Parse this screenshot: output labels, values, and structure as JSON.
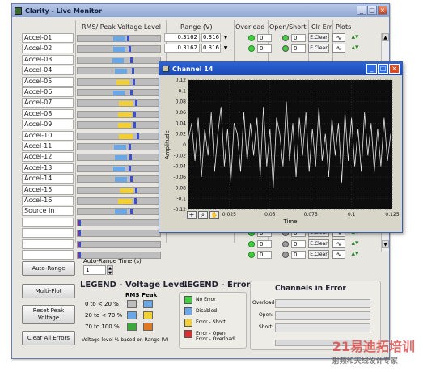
{
  "app": {
    "title": "Clarity - Live Monitor"
  },
  "columns": {
    "rms_peak": "RMS/ Peak Voltage Level",
    "range": "Range (V)",
    "overload": "Overload",
    "open_short": "Open/Short",
    "clr_err": "Clr Err",
    "plots": "Plots"
  },
  "rows": [
    {
      "name": "Accel-01",
      "rms": 0.58,
      "peak": 0.6,
      "range_a": "0.3162",
      "range_b": "0.316",
      "color": "#6aa7e6",
      "overload": "0",
      "open": "0",
      "clear": "E.Clear"
    },
    {
      "name": "Accel-02",
      "rms": 0.58,
      "peak": 0.62,
      "range_a": "0.3162",
      "range_b": "0.316",
      "color": "#6aa7e6",
      "overload": "0",
      "open": "0",
      "clear": "E.Clear"
    },
    {
      "name": "Accel-03",
      "rms": 0.56,
      "peak": 0.64,
      "range_a": "",
      "range_b": "",
      "color": "#6aa7e6",
      "overload": "",
      "open": "",
      "clear": ""
    },
    {
      "name": "Accel-04",
      "rms": 0.6,
      "peak": 0.66,
      "range_a": "",
      "range_b": "",
      "color": "#6aa7e6",
      "overload": "",
      "open": "",
      "clear": ""
    },
    {
      "name": "Accel-05",
      "rms": 0.63,
      "peak": 0.67,
      "range_a": "",
      "range_b": "",
      "color": "#f2d033",
      "overload": "",
      "open": "",
      "clear": ""
    },
    {
      "name": "Accel-06",
      "rms": 0.57,
      "peak": 0.64,
      "range_a": "",
      "range_b": "",
      "color": "#6aa7e6",
      "overload": "",
      "open": "",
      "clear": ""
    },
    {
      "name": "Accel-07",
      "rms": 0.67,
      "peak": 0.7,
      "range_a": "",
      "range_b": "",
      "color": "#f2d033",
      "overload": "",
      "open": "",
      "clear": ""
    },
    {
      "name": "Accel-08",
      "rms": 0.66,
      "peak": 0.68,
      "range_a": "",
      "range_b": "",
      "color": "#f2d033",
      "overload": "",
      "open": "",
      "clear": ""
    },
    {
      "name": "Accel-09",
      "rms": 0.65,
      "peak": 0.68,
      "range_a": "",
      "range_b": "",
      "color": "#f2d033",
      "overload": "",
      "open": "",
      "clear": ""
    },
    {
      "name": "Accel-10",
      "rms": 0.67,
      "peak": 0.72,
      "range_a": "",
      "range_b": "",
      "color": "#f2d033",
      "overload": "",
      "open": "",
      "clear": ""
    },
    {
      "name": "Accel-11",
      "rms": 0.59,
      "peak": 0.62,
      "range_a": "",
      "range_b": "",
      "color": "#6aa7e6",
      "overload": "",
      "open": "",
      "clear": ""
    },
    {
      "name": "Accel-12",
      "rms": 0.6,
      "peak": 0.63,
      "range_a": "",
      "range_b": "",
      "color": "#6aa7e6",
      "overload": "",
      "open": "",
      "clear": ""
    },
    {
      "name": "Accel-13",
      "rms": 0.58,
      "peak": 0.62,
      "range_a": "",
      "range_b": "",
      "color": "#6aa7e6",
      "overload": "",
      "open": "",
      "clear": ""
    },
    {
      "name": "Accel-14",
      "rms": 0.6,
      "peak": 0.64,
      "range_a": "",
      "range_b": "",
      "color": "#6aa7e6",
      "overload": "",
      "open": "",
      "clear": ""
    },
    {
      "name": "Accel-15",
      "rms": 0.68,
      "peak": 0.7,
      "range_a": "",
      "range_b": "",
      "color": "#f2d033",
      "overload": "",
      "open": "",
      "clear": ""
    },
    {
      "name": "Accel-16",
      "rms": 0.66,
      "peak": 0.69,
      "range_a": "",
      "range_b": "",
      "color": "#f2d033",
      "overload": "",
      "open": "",
      "clear": ""
    },
    {
      "name": "Source In",
      "rms": 0.6,
      "peak": 0.64,
      "range_a": "",
      "range_b": "",
      "color": "#6aa7e6",
      "overload": "",
      "open": "",
      "clear": ""
    },
    {
      "name": "",
      "rms": 0.0,
      "peak": 0.01,
      "range_a": "",
      "range_b": "",
      "color": "#d83030",
      "overload": "",
      "open": "",
      "clear": ""
    },
    {
      "name": "",
      "rms": 0.0,
      "peak": 0.01,
      "range_a": "",
      "range_b": "",
      "color": "#d83030",
      "overload": "0",
      "open": "0",
      "clear": "E.Clear"
    },
    {
      "name": "",
      "rms": 0.0,
      "peak": 0.01,
      "range_a": "",
      "range_b": "",
      "color": "#d83030",
      "overload": "0",
      "open": "0",
      "clear": "E.Clear"
    },
    {
      "name": "",
      "rms": 0.0,
      "peak": 0.01,
      "range_a": "",
      "range_b": "",
      "color": "#d83030",
      "overload": "0",
      "open": "0",
      "clear": "E.Clear"
    }
  ],
  "controls": {
    "auto_range": "Auto-Range",
    "auto_range_time_label": "Auto-Range Time (s)",
    "auto_range_time_value": "1",
    "multi_plot": "Multi-Plot",
    "reset_peak": "Reset Peak\nVoltage",
    "clear_all": "Clear All Errors"
  },
  "legend_voltage": {
    "title": "LEGEND - Voltage Level",
    "col_rms": "RMS",
    "col_peak": "Peak",
    "rows": [
      {
        "label": "0 to < 20 %",
        "rms_color": "#bdbdbd",
        "peak_color": "#6aa7e6"
      },
      {
        "label": "20 to < 70 %",
        "rms_color": "#6aa7e6",
        "peak_color": "#f2d033"
      },
      {
        "label": "70 to 100 %",
        "rms_color": "#3aa83a",
        "peak_color": "#e07a22"
      }
    ],
    "note": "Voltage level % based on Range (V)"
  },
  "legend_errors": {
    "title": "LEGEND - Errors",
    "items": [
      {
        "label": "No Error",
        "color": "#3fcf3f"
      },
      {
        "label": "Disabled",
        "color": "#6aa7e6"
      },
      {
        "label": "Error - Short",
        "color": "#f2d033"
      },
      {
        "label": "Error - Open\nError - Overload",
        "color": "#d83030"
      }
    ]
  },
  "channels_in_error": {
    "title": "Channels in Error",
    "fields": [
      "Overload:",
      "Open:",
      "Short:"
    ]
  },
  "chart_window": {
    "title": "Channel 14",
    "ylabel": "Amplitude",
    "xlabel": "Time"
  },
  "chart_data": {
    "type": "line",
    "title": "",
    "xlabel": "Time",
    "ylabel": "Amplitude",
    "xlim": [
      0,
      0.125
    ],
    "ylim": [
      -0.12,
      0.12
    ],
    "xticks": [
      "0",
      "0.025",
      "0.05",
      "0.075",
      "0.1",
      "0.125"
    ],
    "yticks": [
      "0.12",
      "0.1",
      "0.08",
      "0.06",
      "0.04",
      "0.02",
      "0",
      "-0.02",
      "-0.04",
      "-0.06",
      "-0.08",
      "-0.1",
      "-0.12"
    ],
    "series": [
      {
        "line_color": "#e6e6e6",
        "x": [
          0,
          0.002,
          0.004,
          0.006,
          0.008,
          0.01,
          0.012,
          0.014,
          0.016,
          0.018,
          0.02,
          0.022,
          0.024,
          0.026,
          0.028,
          0.03,
          0.032,
          0.034,
          0.036,
          0.038,
          0.04,
          0.042,
          0.044,
          0.046,
          0.048,
          0.05,
          0.052,
          0.054,
          0.056,
          0.058,
          0.06,
          0.062,
          0.064,
          0.066,
          0.068,
          0.07,
          0.072,
          0.074,
          0.076,
          0.078,
          0.08,
          0.082,
          0.084,
          0.086,
          0.088,
          0.09,
          0.092,
          0.094,
          0.096,
          0.098,
          0.1,
          0.102,
          0.104,
          0.106,
          0.108,
          0.11,
          0.112,
          0.114,
          0.116,
          0.118,
          0.12,
          0.122,
          0.124
        ],
        "values": [
          0.01,
          0.04,
          -0.03,
          0.05,
          -0.06,
          0.03,
          -0.02,
          0.06,
          -0.05,
          0.02,
          0.07,
          -0.04,
          0.03,
          -0.07,
          0.04,
          0.02,
          -0.05,
          0.06,
          -0.03,
          0.04,
          -0.02,
          0.05,
          -0.06,
          0.07,
          -0.04,
          0.03,
          -0.08,
          0.05,
          0.02,
          -0.04,
          0.08,
          -0.03,
          0.04,
          -0.06,
          0.05,
          -0.02,
          0.06,
          -0.05,
          0.03,
          -0.04,
          0.07,
          -0.03,
          0.02,
          -0.06,
          0.05,
          -0.02,
          0.04,
          -0.07,
          0.06,
          -0.03,
          0.05,
          -0.04,
          0.03,
          -0.05,
          0.06,
          -0.02,
          0.04,
          -0.05,
          0.03,
          -0.04,
          0.05,
          -0.03,
          0.02
        ]
      }
    ],
    "grid": true,
    "background": "#0d0d0d"
  },
  "chart_toolbar": [
    "+",
    "pan",
    "zoom"
  ],
  "watermark": {
    "line1": "21易迪拓培训",
    "line2": "射频和天线设计专家"
  }
}
